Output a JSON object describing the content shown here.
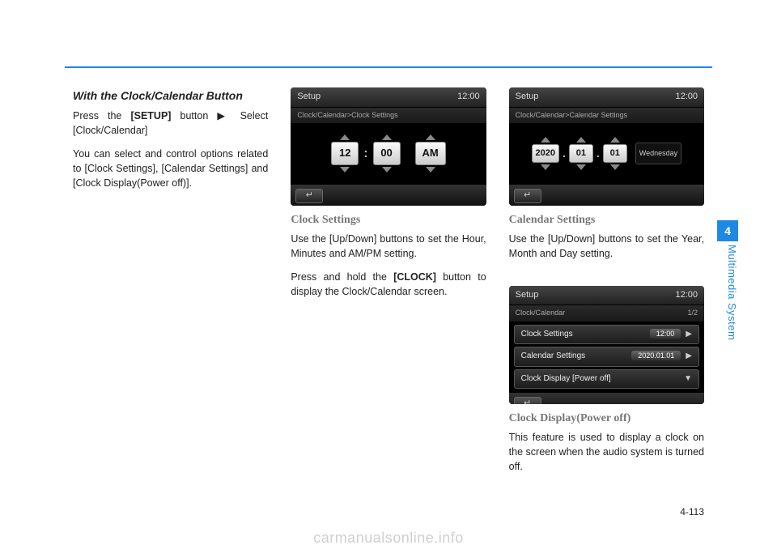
{
  "rule_color": "#1e88e5",
  "col1": {
    "title": "With the Clock/Calendar Button",
    "p1_a": "Press the ",
    "p1_b": "[SETUP]",
    "p1_c": " button ▶ Select [Clock/Calendar]",
    "p2": "You can select and control options related to [Clock Settings], [Calendar Settings] and [Clock Display(Power off)]."
  },
  "clockScreen": {
    "title": "Setup",
    "time": "12:00",
    "breadcrumb": "Clock/Calendar>Clock Settings",
    "hour": "12",
    "minute": "00",
    "ampm": "AM"
  },
  "clockSection": {
    "heading": "Clock Settings",
    "p1": "Use the [Up/Down] buttons to set the Hour, Minutes and AM/PM setting.",
    "p2_a": "Press and hold the ",
    "p2_b": "[CLOCK]",
    "p2_c": " button to display the Clock/Calendar screen."
  },
  "calScreen": {
    "title": "Setup",
    "time": "12:00",
    "breadcrumb": "Clock/Calendar>Calendar Settings",
    "year": "2020",
    "month": "01",
    "day": "01",
    "weekday": "Wednesday"
  },
  "calSection": {
    "heading": "Calendar Settings",
    "p1": "Use the [Up/Down] buttons to set the Year, Month and Day setting."
  },
  "listScreen": {
    "title": "Setup",
    "time": "12:00",
    "breadcrumb": "Clock/Calendar",
    "pager": "1/2",
    "rows": [
      {
        "label": "Clock Settings",
        "value": "12:00"
      },
      {
        "label": "Calendar Settings",
        "value": "2020.01.01"
      },
      {
        "label": "Clock Display [Power off]",
        "value": ""
      }
    ]
  },
  "cdSection": {
    "heading": "Clock Display(Power off)",
    "p1": "This feature is used to display a clock on the screen when the audio sys­tem is turned off."
  },
  "sideTab": {
    "num": "4",
    "label": "Multimedia System"
  },
  "pageNum": "4-113",
  "watermark": "carmanualsonline.info"
}
